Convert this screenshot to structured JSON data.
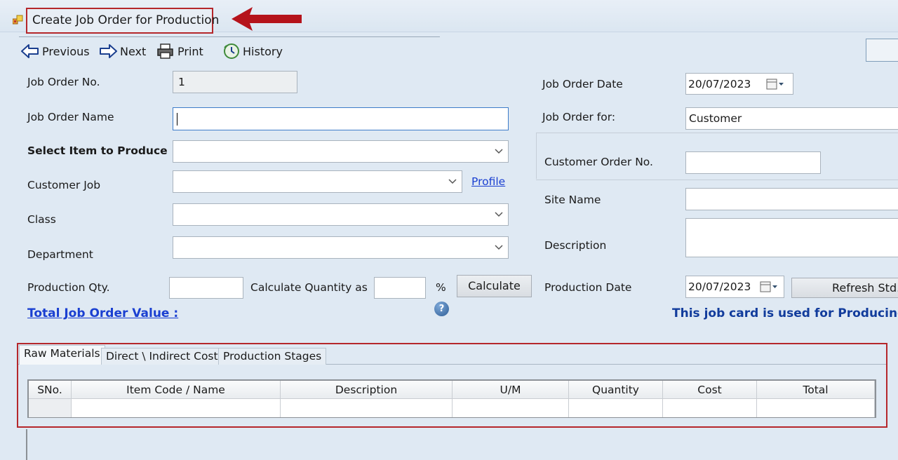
{
  "window": {
    "title": "Create Job Order for Production"
  },
  "toolbar": {
    "previous": "Previous",
    "next": "Next",
    "print": "Print",
    "history": "History"
  },
  "form": {
    "job_order_no": {
      "label": "Job Order No.",
      "value": "1"
    },
    "job_order_name": {
      "label": "Job Order Name",
      "value": ""
    },
    "select_item": {
      "label": "Select Item to Produce",
      "value": ""
    },
    "customer_job": {
      "label": "Customer Job",
      "value": "",
      "link": "Profile"
    },
    "class": {
      "label": "Class",
      "value": ""
    },
    "department": {
      "label": "Department",
      "value": ""
    },
    "production_qty": {
      "label": "Production Qty.",
      "value": ""
    },
    "calculate_qty_as": {
      "label": "Calculate Quantity as",
      "value": "",
      "unit": "%"
    },
    "calculate_button": "Calculate",
    "help_icon": "?",
    "total_value_label": "Total Job Order Value :",
    "job_order_date": {
      "label": "Job Order Date",
      "value": "20/07/2023"
    },
    "job_order_for": {
      "label": "Job Order for:",
      "value": "Customer"
    },
    "customer_order_no": {
      "label": "Customer Order No.",
      "value": ""
    },
    "site_name": {
      "label": "Site Name",
      "value": ""
    },
    "description": {
      "label": "Description",
      "value": ""
    },
    "production_date": {
      "label": "Production Date",
      "value": "20/07/2023"
    },
    "refresh_button": "Refresh Std.",
    "info_text": "This job card is used for Producing"
  },
  "tabs": [
    {
      "label": "Raw Materials",
      "active": true
    },
    {
      "label": "Direct \\ Indirect Cost",
      "active": false
    },
    {
      "label": "Production Stages",
      "active": false
    }
  ],
  "grid": {
    "columns": [
      "SNo.",
      "Item Code / Name",
      "Description",
      "U/M",
      "Quantity",
      "Cost",
      "Total"
    ]
  },
  "colors": {
    "highlight": "#b5272b",
    "link": "#1a3fd1",
    "info": "#123c9c"
  }
}
